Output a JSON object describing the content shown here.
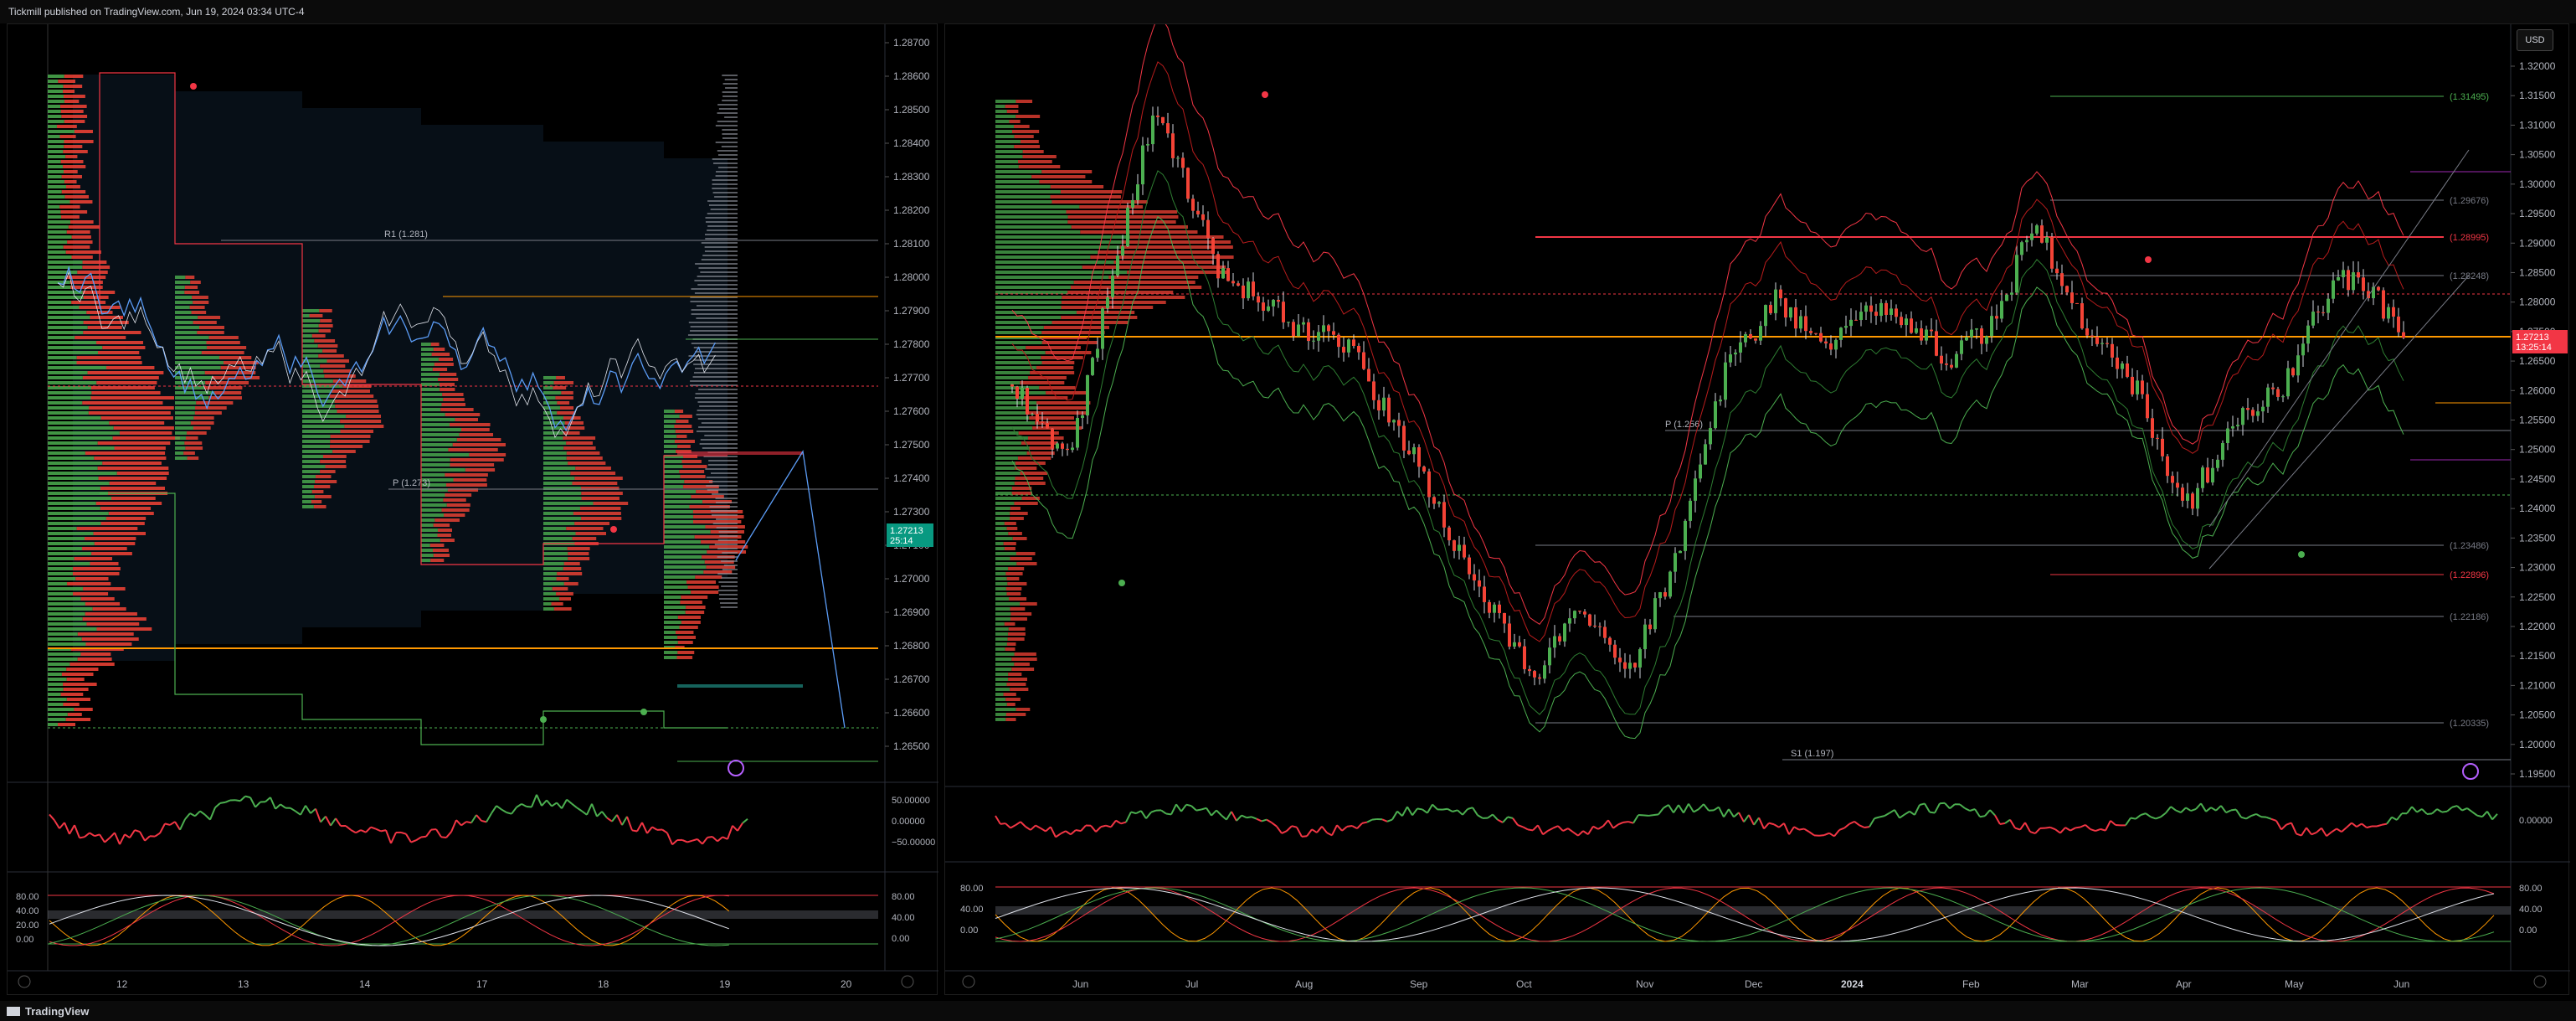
{
  "header": {
    "publisher_text": "Tickmill published on TradingView.com, Jun 19, 2024 03:34 UTC-4"
  },
  "footer": {
    "brand": "TradingView"
  },
  "left_chart": {
    "price_axis": [
      "1.28700",
      "1.28600",
      "1.28500",
      "1.28400",
      "1.28300",
      "1.28200",
      "1.28100",
      "1.28000",
      "1.27900",
      "1.27800",
      "1.27700",
      "1.27600",
      "1.27500",
      "1.27400",
      "1.27300",
      "1.27100",
      "1.27000",
      "1.26900",
      "1.26800",
      "1.26700",
      "1.26600",
      "1.26500"
    ],
    "current_price": "1.27213",
    "countdown": "25:14",
    "pivot_labels": {
      "r1": "R1 (1.281)",
      "p": "P (1.273)"
    },
    "time_axis": [
      "12",
      "13",
      "14",
      "17",
      "18",
      "19",
      "20"
    ],
    "osc_axis": [
      "50.00000",
      "0.00000",
      "−50.00000"
    ],
    "stoch_axis": [
      "80.00",
      "40.00",
      "0.00"
    ],
    "stoch_left_axis": [
      "80.00",
      "40.00",
      "20.00",
      "0.00"
    ]
  },
  "right_chart": {
    "currency_button": "USD",
    "price_axis": [
      "1.32000",
      "1.31500",
      "1.31000",
      "1.30500",
      "1.30000",
      "1.29500",
      "1.29000",
      "1.28500",
      "1.28000",
      "1.27500",
      "1.26500",
      "1.26000",
      "1.25500",
      "1.25000",
      "1.24500",
      "1.24000",
      "1.23500",
      "1.23000",
      "1.22500",
      "1.22000",
      "1.21500",
      "1.21000",
      "1.20500",
      "1.20000",
      "1.19500"
    ],
    "current_price": "1.27213",
    "countdown": "13:25:14",
    "level_labels": [
      "(1.31495)",
      "(1.29676)",
      "(1.28995)",
      "(1.28248)",
      "(1.23486)",
      "(1.22896)",
      "(1.22186)",
      "(1.20335)"
    ],
    "pivot_labels": {
      "p": "P (1.256)",
      "s1": "S1 (1.197)"
    },
    "time_axis": [
      "Jun",
      "Jul",
      "Aug",
      "Sep",
      "Oct",
      "Nov",
      "Dec",
      "2024",
      "Feb",
      "Mar",
      "Apr",
      "May",
      "Jun"
    ],
    "osc_axis": [
      "0.00000"
    ],
    "stoch_axis": [
      "80.00",
      "40.00",
      "0.00"
    ],
    "stoch_right_axis": [
      "80.00",
      "40.00",
      "0.00"
    ]
  },
  "colors": {
    "up": "#26a69a",
    "down": "#f23645",
    "volume_up": "#4caf50",
    "volume_down": "#f44336",
    "accent_orange": "#ff9800",
    "price_badge_green": "#089981",
    "price_badge_red": "#f23645"
  }
}
